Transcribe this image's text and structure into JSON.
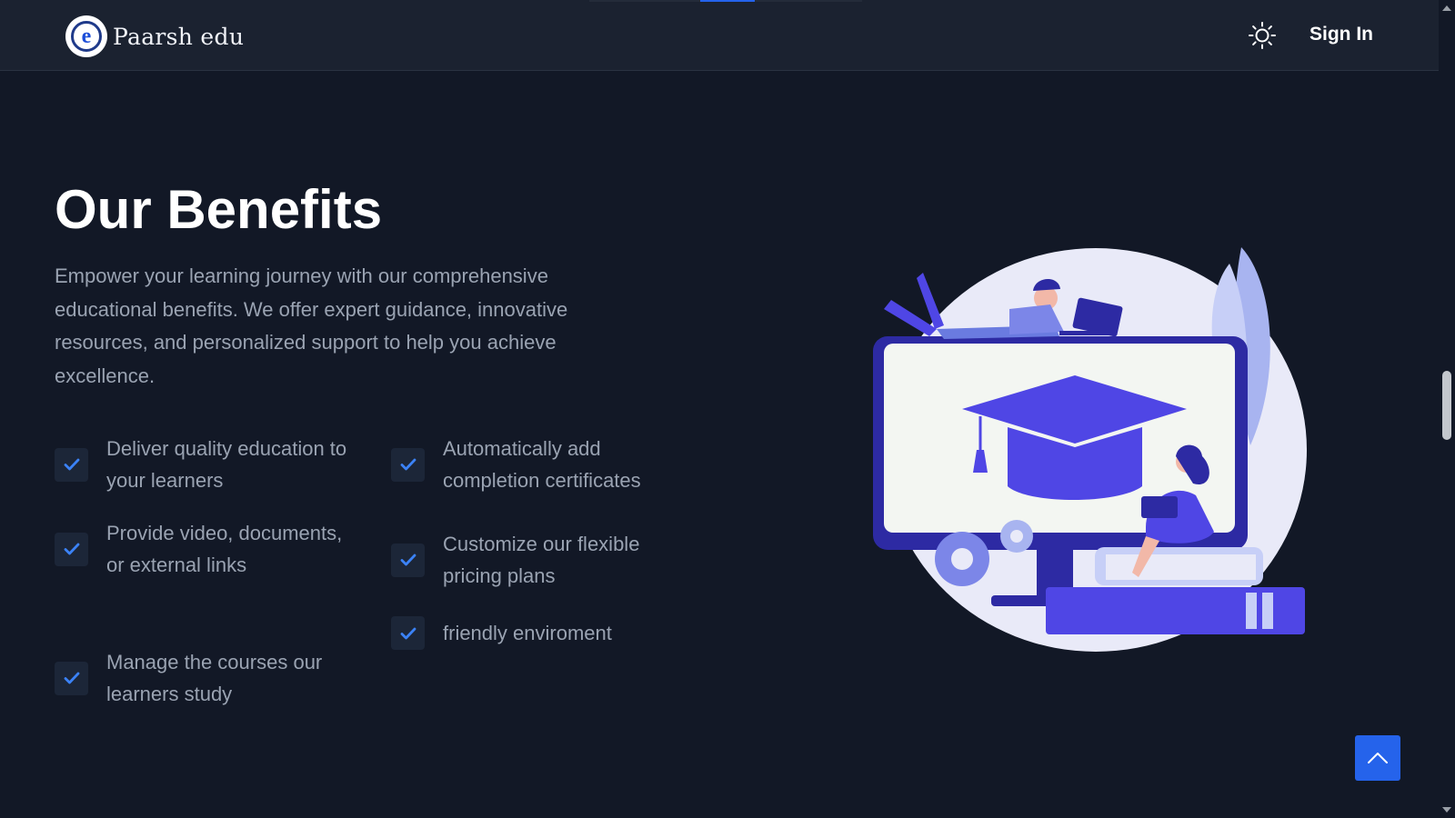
{
  "header": {
    "logo_text": "Paarsh edu",
    "logo_letter": "e",
    "sign_in_label": "Sign In",
    "theme_icon": "sun-icon"
  },
  "benefits": {
    "title": "Our Benefits",
    "description": "Empower your learning journey with our comprehensive educational benefits. We offer expert guidance, innovative resources, and personalized support to help you achieve excellence.",
    "items": [
      {
        "label": "Deliver quality education to your learners"
      },
      {
        "label": "Provide video, documents, or external links"
      },
      {
        "label": "Manage the courses our learners study"
      },
      {
        "label": "Automatically add completion certificates"
      },
      {
        "label": "Customize our flexible pricing plans"
      },
      {
        "label": "friendly enviroment"
      }
    ]
  },
  "colors": {
    "background": "#121826",
    "header_bg": "#1b2230",
    "accent": "#2563eb",
    "text_muted": "#9aa3b2",
    "illustration_primary": "#4f46e5"
  },
  "scroll_to_top_icon": "chevron-up-icon"
}
